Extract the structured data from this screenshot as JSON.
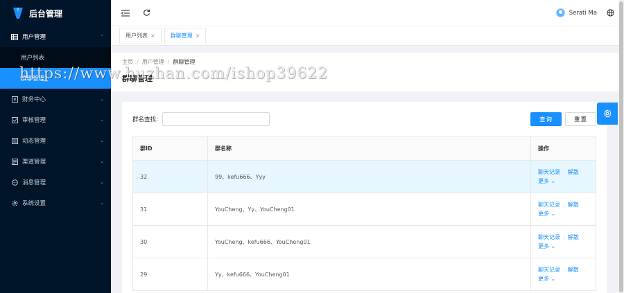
{
  "app": {
    "title": "后台管理",
    "brand_color": "#1890ff"
  },
  "sidebar": {
    "items": [
      {
        "label": "用户管理",
        "icon": "table-icon",
        "open": true,
        "children": [
          {
            "label": "用户列表"
          },
          {
            "label": "群聊管理",
            "active": true
          }
        ]
      },
      {
        "label": "财务中心",
        "icon": "finance-icon"
      },
      {
        "label": "审核管理",
        "icon": "check-square-icon"
      },
      {
        "label": "动态管理",
        "icon": "dynamic-icon"
      },
      {
        "label": "渠道管理",
        "icon": "channel-icon"
      },
      {
        "label": "消息管理",
        "icon": "message-icon"
      },
      {
        "label": "系统设置",
        "icon": "gear-icon"
      }
    ]
  },
  "header": {
    "user_name": "Serati Ma"
  },
  "tabs": [
    {
      "label": "用户列表",
      "close": "×"
    },
    {
      "label": "群聊管理",
      "close": "×",
      "active": true
    }
  ],
  "breadcrumb": {
    "items": [
      "主页",
      "用户管理",
      "群聊管理"
    ],
    "separator": "/"
  },
  "page": {
    "title": "群聊管理"
  },
  "search": {
    "label": "群名查找:",
    "value": "",
    "placeholder": ""
  },
  "buttons": {
    "query": "查询",
    "reset": "重置"
  },
  "table": {
    "columns": [
      "群ID",
      "群名称",
      "操作"
    ],
    "rows": [
      {
        "id": "32",
        "name": "99、kefu666、Yyy",
        "highlight": true
      },
      {
        "id": "31",
        "name": "YouCheng、Yy、YouCheng01"
      },
      {
        "id": "30",
        "name": "YouCheng、kefu666、YouCheng01"
      },
      {
        "id": "29",
        "name": "Yy、kefu666、YouCheng01"
      }
    ],
    "actions": {
      "records": "聊天记录",
      "dissolve": "解散",
      "more": "更多",
      "more_icon": "chevron-down-icon"
    }
  },
  "watermark": {
    "text": "https://www.huzhan.com/ishop39622"
  }
}
